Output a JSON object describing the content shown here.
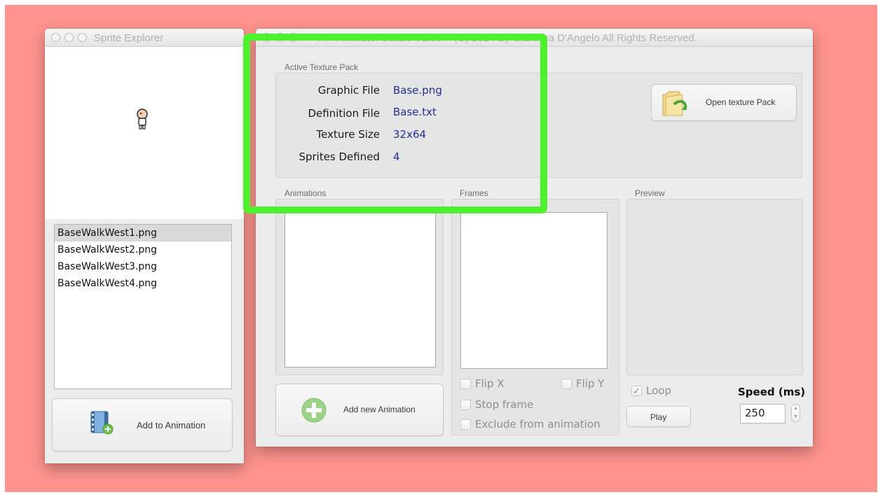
{
  "sprite_explorer": {
    "title": "Sprite Explorer",
    "sprites": [
      "BaseWalkWest1.png",
      "BaseWalkWest2.png",
      "BaseWalkWest3.png",
      "BaseWalkWest4.png"
    ],
    "selected_index": 0,
    "add_button_label": "Add to Animation"
  },
  "main_window": {
    "title": "– TnT Animator Studio V1.00 – (C) 2014 By Gianluca D'Angelo All Rights Reserved.",
    "texture_pack": {
      "group_label": "Active Texture Pack",
      "graphic_file_label": "Graphic File",
      "graphic_file_value": "Base.png",
      "definition_file_label": "Definition File",
      "definition_file_value": "Base.txt",
      "texture_size_label": "Texture Size",
      "texture_size_value": "32x64",
      "sprites_defined_label": "Sprites Defined",
      "sprites_defined_value": "4",
      "open_button_label": "Open texture Pack"
    },
    "animations": {
      "group_label": "Animations",
      "add_button_label": "Add new Animation"
    },
    "frames": {
      "group_label": "Frames",
      "flip_x_label": "Flip X",
      "flip_y_label": "Flip Y",
      "stop_frame_label": "Stop frame",
      "exclude_label": "Exclude from animation"
    },
    "preview": {
      "group_label": "Preview",
      "loop_label": "Loop",
      "loop_checked": true,
      "play_label": "Play",
      "speed_label": "Speed (ms)",
      "speed_value": "250"
    }
  },
  "colors": {
    "desktop_background": "#ff948e",
    "highlight_box": "#4ef12e",
    "value_text": "#1f2f9a"
  }
}
